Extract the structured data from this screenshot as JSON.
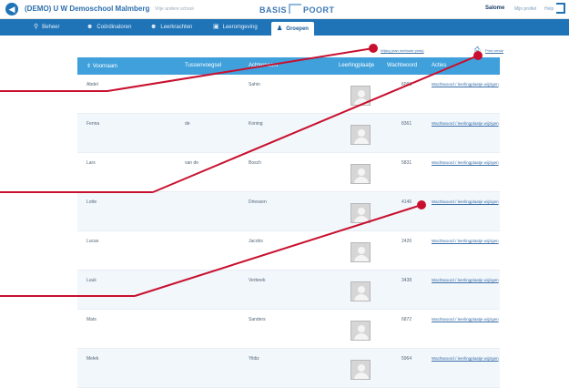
{
  "header": {
    "school_name": "(DEMO) U W Demoschool Malmberg",
    "school_sub": "Vrije andere school",
    "logo_left": "BASIS",
    "logo_right": "POORT",
    "user_name": "Salome",
    "profile_link": "Mijn profiel",
    "help_link": "Help"
  },
  "nav": {
    "items": [
      {
        "label": "Beheer",
        "icon": "search-icon"
      },
      {
        "label": "Coördinatoren",
        "icon": "person-icon"
      },
      {
        "label": "Leerkrachten",
        "icon": "person-icon"
      },
      {
        "label": "Leeromgeving",
        "icon": "screen-icon"
      },
      {
        "label": "Groepen",
        "icon": "group-icon"
      }
    ]
  },
  "toolbar": {
    "methods_link": "Wijzig (ean methode pinta)",
    "print_link": "Print versie"
  },
  "table": {
    "columns": [
      "Voornaam",
      "Tussenvoegsel",
      "Achternaam",
      "Leerlingplaatje",
      "Wachtwoord",
      "Acties"
    ],
    "rows": [
      {
        "first": "Abdel",
        "mid": "",
        "last": "Sahin",
        "password": "6093",
        "action": "Wachtwoord / leerlingplaatje wijzigen"
      },
      {
        "first": "Fenna",
        "mid": "de",
        "last": "Koning",
        "password": "8361",
        "action": "Wachtwoord / leerlingplaatje wijzigen"
      },
      {
        "first": "Lars",
        "mid": "van de",
        "last": "Bosch",
        "password": "5831",
        "action": "Wachtwoord / leerlingplaatje wijzigen"
      },
      {
        "first": "Lotte",
        "mid": "",
        "last": "Driessen",
        "password": "4146",
        "action": "Wachtwoord / leerlingplaatje wijzigen"
      },
      {
        "first": "Lucas",
        "mid": "",
        "last": "Jacobs",
        "password": "2426",
        "action": "Wachtwoord / leerlingplaatje wijzigen"
      },
      {
        "first": "Luuk",
        "mid": "",
        "last": "Verbeek",
        "password": "3438",
        "action": "Wachtwoord / leerlingplaatje wijzigen"
      },
      {
        "first": "Mats",
        "mid": "",
        "last": "Sanders",
        "password": "6872",
        "action": "Wachtwoord / leerlingplaatje wijzigen"
      },
      {
        "first": "Melek",
        "mid": "",
        "last": "Yildiz",
        "password": "5964",
        "action": "Wachtwoord / leerlingplaatje wijzigen"
      }
    ]
  },
  "colors": {
    "nav_blue": "#1f74b8",
    "header_blue": "#3fa0db",
    "callout_red": "#c8102e"
  }
}
